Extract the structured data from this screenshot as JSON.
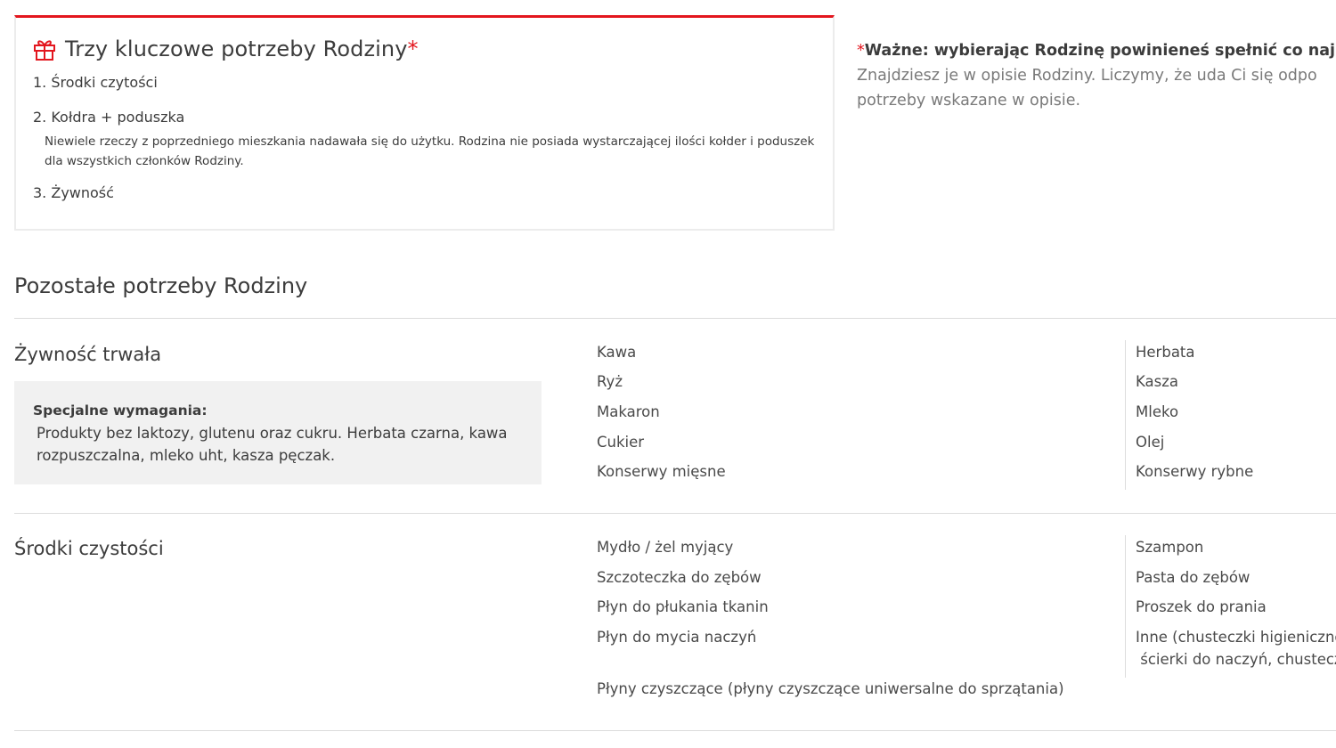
{
  "key_needs": {
    "title": "Trzy kluczowe potrzeby Rodziny",
    "star": "*",
    "items": [
      "1. Środki czytości",
      "2. Kołdra + poduszka",
      "3. Żywność"
    ],
    "item2_description": "Niewiele rzeczy z poprzedniego mieszkania nadawała się do użytku. Rodzina nie posiada wystarczającej ilości kołder i poduszek dla wszystkich członków Rodziny."
  },
  "important_note": {
    "star": "*",
    "bold_text": "Ważne: wybierając Rodzinę powinieneś spełnić co najm",
    "line2": "Znajdziesz je w opisie Rodziny. Liczymy, że uda Ci się odpo",
    "line3": "potrzeby wskazane w opisie."
  },
  "other_needs": {
    "title": "Pozostałe potrzeby Rodziny",
    "categories": [
      {
        "title": "Żywność trwała",
        "special_label": "Specjalne wymagania:",
        "special_text": "Produkty bez laktozy, glutenu oraz cukru. Herbata czarna, kawa rozpuszczalna, mleko uht, kasza pęczak.",
        "col1": [
          "Kawa",
          "Ryż",
          "Makaron",
          "Cukier",
          "Konserwy mięsne"
        ],
        "col2": [
          "Herbata",
          "Kasza",
          "Mleko",
          "Olej",
          "Konserwy rybne"
        ]
      },
      {
        "title": "Środki czystości",
        "col1": [
          "Mydło / żel myjący",
          "Szczoteczka do zębów",
          "Płyn do płukania tkanin",
          "Płyn do mycia naczyń"
        ],
        "col2": [
          "Szampon",
          "Pasta do zębów",
          "Proszek do prania",
          "Inne (chusteczki higieniczne",
          " ścierki do naczyń, chustecz"
        ],
        "extra": "Płyny czyszczące (płyny czyszczące uniwersalne do sprzątania)"
      }
    ]
  },
  "colors": {
    "accent": "#e3161e",
    "text": "#3c3c3c",
    "muted": "#7a7a7a",
    "panel": "#f1f1f1"
  }
}
